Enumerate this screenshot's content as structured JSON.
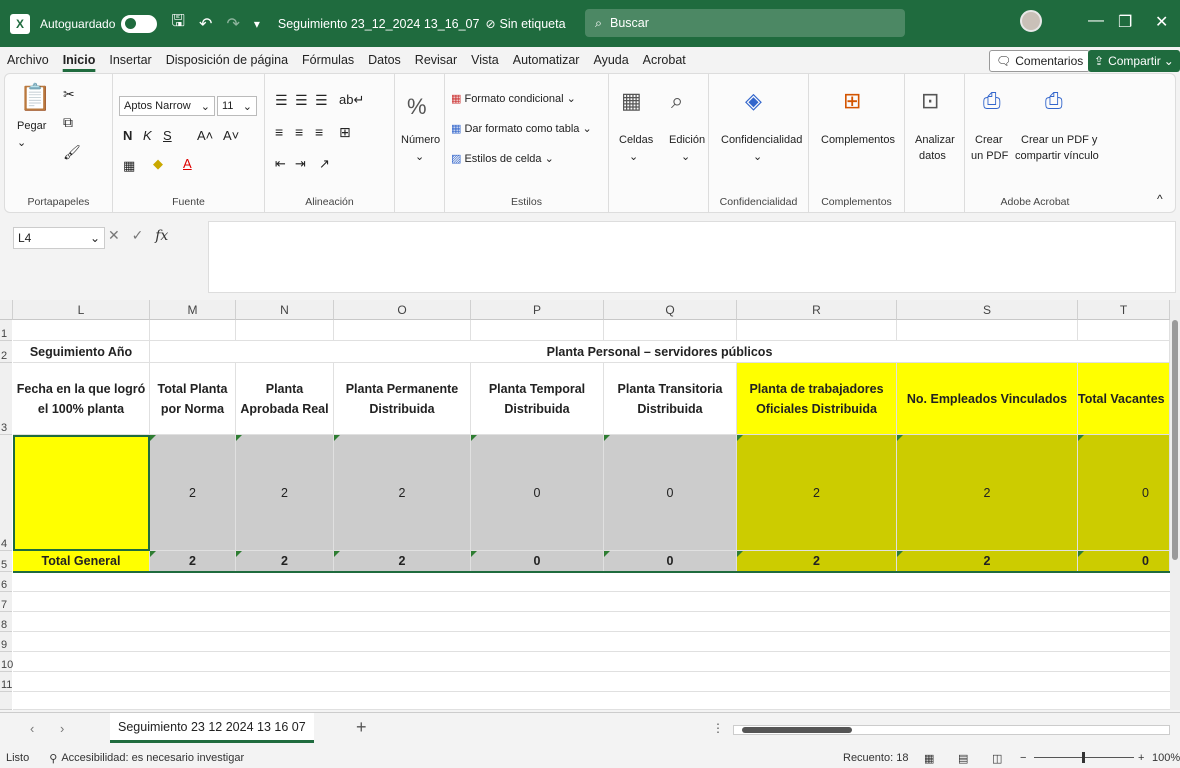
{
  "title_bar": {
    "autosave_label": "Autoguardado",
    "file_title": "Seguimiento 23_12_2024 13_16_07",
    "label_status": "Sin etiqueta",
    "search_placeholder": "Buscar"
  },
  "menu": {
    "items": [
      "Archivo",
      "Inicio",
      "Insertar",
      "Disposición de página",
      "Fórmulas",
      "Datos",
      "Revisar",
      "Vista",
      "Automatizar",
      "Ayuda",
      "Acrobat"
    ],
    "comments_label": "Comentarios",
    "share_label": "Compartir"
  },
  "ribbon": {
    "portapapeles": {
      "paste_label": "Pegar",
      "group_label": "Portapapeles"
    },
    "fuente": {
      "font_name": "Aptos Narrow",
      "font_size": "11",
      "group_label": "Fuente"
    },
    "alineacion": {
      "group_label": "Alineación"
    },
    "numero": {
      "label": "Número"
    },
    "estilos": {
      "conditional": "Formato condicional",
      "as_table": "Dar formato como tabla",
      "cell_styles": "Estilos de celda",
      "group_label": "Estilos"
    },
    "celdas": {
      "label": "Celdas"
    },
    "edicion": {
      "label": "Edición"
    },
    "confidencialidad": {
      "label": "Confidencialidad",
      "group_label": "Confidencialidad"
    },
    "complementos": {
      "label": "Complementos",
      "group_label": "Complementos"
    },
    "analizar": {
      "label1": "Analizar",
      "label2": "datos"
    },
    "acrobat": {
      "crear1": "Crear",
      "crear2": "un PDF",
      "share1": "Crear un PDF y",
      "share2": "compartir vínculo",
      "group_label": "Adobe Acrobat"
    }
  },
  "formula_bar": {
    "name_box": "L4",
    "formula": ""
  },
  "grid": {
    "columns": [
      "L",
      "M",
      "N",
      "O",
      "P",
      "Q",
      "R",
      "S",
      "T"
    ],
    "rows": [
      "1",
      "2",
      "3",
      "4",
      "5",
      "6",
      "7",
      "8",
      "9",
      "10",
      "11"
    ],
    "r2_L": "Seguimiento Año",
    "r2_merged": "Planta Personal – servidores públicos",
    "r3": [
      "Fecha en la que logró el 100% planta",
      "Total Planta por Norma",
      "Planta Aprobada Real",
      "Planta Permanente Distribuida",
      "Planta Temporal Distribuida",
      "Planta Transitoria Distribuida",
      "Planta de trabajadores Oficiales Distribuida",
      "No. Empleados Vinculados",
      "Total Vacantes"
    ],
    "r4": [
      "",
      "2",
      "2",
      "2",
      "0",
      "0",
      "2",
      "2",
      "0"
    ],
    "r5_label": "Total General",
    "r5": [
      "2",
      "2",
      "2",
      "0",
      "0",
      "2",
      "2",
      "0"
    ]
  },
  "sheet_tab": "Seguimiento 23 12 2024 13 16 07",
  "status": {
    "ready": "Listo",
    "accessibility": "Accesibilidad: es necesario investigar",
    "count": "Recuento: 18",
    "zoom": "100%"
  },
  "colors": {
    "excel_green": "#1f6b3e",
    "yellow": "#ffff00",
    "gray": "#cccccc",
    "olive": "#cccc00"
  }
}
